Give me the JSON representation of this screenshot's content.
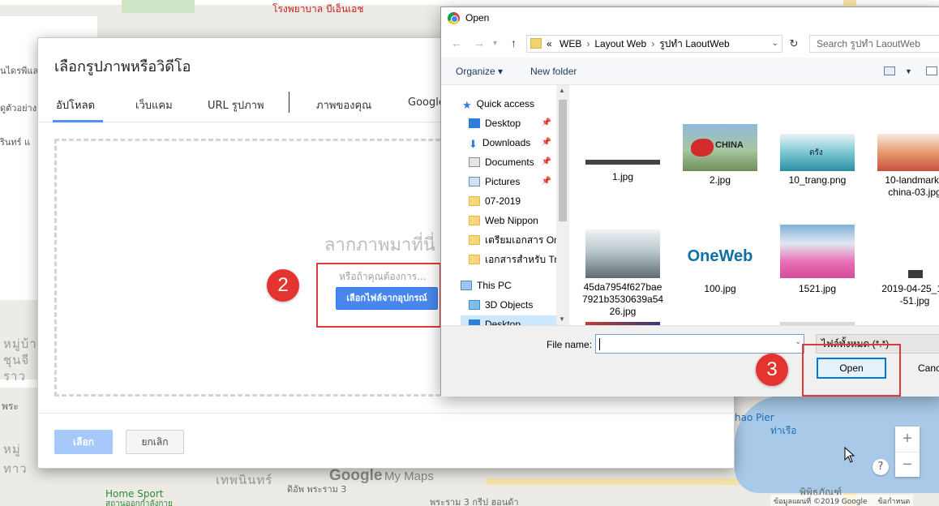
{
  "map": {
    "labels": {
      "hospital": "โรงพยาบาล บีเอ็นเอช",
      "road_a": "หมู่บ้าน",
      "road_b": "ชุนจี",
      "road_c": "ราว",
      "home_sport": "Home Sport",
      "home_sport_sub": "สถานออกกำลังกาย",
      "district": "เทพนินทร์",
      "pier": "hao Pier",
      "pier_sub": "ท่าเรือ",
      "rama3": "ดิอัพ พระราม 3",
      "rama3_bottom": "พระราม 3 กรีป ฮอนด้า",
      "museum": "พิพิธภัณฑ์",
      "left_1": "นไดรพีแล",
      "left_2": "ดูตัวอย่าง",
      "left_3": "รินทร์ แ",
      "left_4": "พระ",
      "left_5": "หมู่",
      "left_6": "ทาว"
    },
    "logo_google": "Google",
    "logo_mymaps": "My Maps",
    "footer": "ข้อมูลแผนที่ ©2019 Google",
    "footer_terms": "ข้อกำหนด",
    "zoom_in": "+",
    "zoom_out": "−",
    "help": "?"
  },
  "picker": {
    "title": "เลือกรูปภาพหรือวิดีโอ",
    "tabs": [
      {
        "label": "อัปโหลด",
        "active": true
      },
      {
        "label": "เว็บแคม"
      },
      {
        "label": "URL รูปภาพ"
      },
      {
        "label": "ภาพของคุณ"
      },
      {
        "label": "Google"
      }
    ],
    "drop_title": "ลากภาพมาที่นี่",
    "drop_or": "หรือถ้าคุณต้องการ...",
    "select_file_button": "เลือกไฟล์จากอุปกรณ์",
    "pick_button": "เลือก",
    "cancel_button": "ยกเลิก"
  },
  "annotations": {
    "step2": "2",
    "step3": "3"
  },
  "open_dialog": {
    "title": "Open",
    "path": [
      "WEB",
      "Layout Web",
      "รูปทำ LaoutWeb"
    ],
    "path_prefix": "«",
    "search_placeholder": "Search รูปทำ LaoutWeb",
    "organize": "Organize ▾",
    "new_folder": "New folder",
    "nav_items": [
      {
        "label": "Quick access",
        "icon": "star-icon"
      },
      {
        "label": "Desktop",
        "icon": "desktop-icon",
        "pinned": true
      },
      {
        "label": "Downloads",
        "icon": "download-icon",
        "pinned": true
      },
      {
        "label": "Documents",
        "icon": "documents-icon",
        "pinned": true
      },
      {
        "label": "Pictures",
        "icon": "pictures-icon",
        "pinned": true
      },
      {
        "label": "07-2019",
        "icon": "folder-icon"
      },
      {
        "label": "Web Nippon",
        "icon": "folder-icon"
      },
      {
        "label": "เตรียมเอกสาร Onsi",
        "icon": "folder-icon"
      },
      {
        "label": "เอกสารสำหรับ Trai",
        "icon": "folder-icon"
      },
      {
        "label": "This PC",
        "icon": "pc-icon"
      },
      {
        "label": "3D Objects",
        "icon": "cube-icon"
      },
      {
        "label": "Desktop",
        "icon": "desktop-icon",
        "selected": true
      }
    ],
    "files": [
      {
        "name": "1.jpg"
      },
      {
        "name": "2.jpg",
        "thumb_text": "CHINA"
      },
      {
        "name": "10_trang.png",
        "thumb_text": "ตรัง"
      },
      {
        "name": "10-landmark-in-china-03.jpg",
        "line1": "10-landmark-i",
        "line2": "china-03.jpg"
      },
      {
        "name": "45da7954f627bae7921b3530639a5426.jpg",
        "line1": "45da7954f627bae",
        "line2": "7921b3530639a54",
        "line3": "26.jpg"
      },
      {
        "name": "100.jpg",
        "thumb_text": "OneWeb"
      },
      {
        "name": "1521.jpg"
      },
      {
        "name": "2019-04-25_13...-51.jpg",
        "line1": "2019-04-25_13",
        "line2": "-51.jpg"
      }
    ],
    "file_name_label": "File name:",
    "file_name_value": "",
    "file_type": "ไฟล์ทั้งหมด (*.*)",
    "open_button": "Open",
    "cancel_button": "Cancel"
  }
}
